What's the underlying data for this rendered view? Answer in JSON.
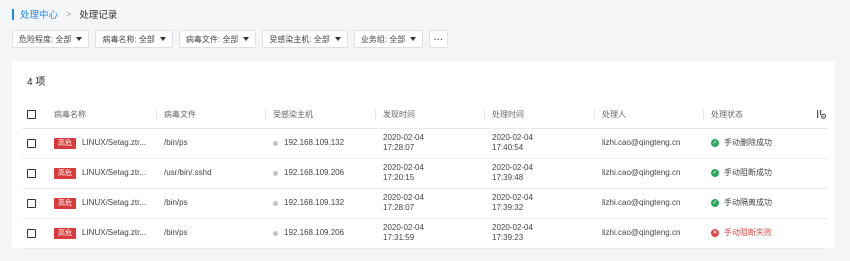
{
  "breadcrumb": {
    "parent": "处理中心",
    "separator": ">",
    "current": "处理记录"
  },
  "filters": [
    {
      "label": "危险程度: 全部"
    },
    {
      "label": "病毒名称: 全部"
    },
    {
      "label": "病毒文件: 全部"
    },
    {
      "label": "受感染主机: 全部"
    },
    {
      "label": "业务组: 全部"
    }
  ],
  "more_label": "···",
  "count_label": "4 项",
  "columns": {
    "name": "病毒名称",
    "file": "病毒文件",
    "host": "受感染主机",
    "found": "发现时间",
    "handled": "处理时间",
    "handler": "处理人",
    "status": "处理状态"
  },
  "rows": [
    {
      "severity": "高危",
      "name": "LINUX/Setag.ztr...",
      "file": "/bin/ps",
      "host": "192.168.109.132",
      "found_date": "2020-02-04",
      "found_time": "17:28:07",
      "handled_date": "2020-02-04",
      "handled_time": "17:40:54",
      "handler": "lizhi.cao@qingteng.cn",
      "status": "手动删除成功",
      "status_type": "success"
    },
    {
      "severity": "高危",
      "name": "LINUX/Setag.ztr...",
      "file": "/usr/bin/.sshd",
      "host": "192.168.109.206",
      "found_date": "2020-02-04",
      "found_time": "17:20:15",
      "handled_date": "2020-02-04",
      "handled_time": "17:39:48",
      "handler": "lizhi.cao@qingteng.cn",
      "status": "手动阻断成功",
      "status_type": "success"
    },
    {
      "severity": "高危",
      "name": "LINUX/Setag.ztr...",
      "file": "/bin/ps",
      "host": "192.168.109.132",
      "found_date": "2020-02-04",
      "found_time": "17:28:07",
      "handled_date": "2020-02-04",
      "handled_time": "17:39:32",
      "handler": "lizhi.cao@qingteng.cn",
      "status": "手动隔离成功",
      "status_type": "success"
    },
    {
      "severity": "高危",
      "name": "LINUX/Setag.ztr...",
      "file": "/bin/ps",
      "host": "192.168.109.206",
      "found_date": "2020-02-04",
      "found_time": "17:31:59",
      "handled_date": "2020-02-04",
      "handled_time": "17:39:23",
      "handler": "lizhi.cao@qingteng.cn",
      "status": "手动阻断失败",
      "status_type": "fail"
    }
  ],
  "colors": {
    "accent": "#1e88e5",
    "severity_high": "#d93a3a",
    "success": "#27a85a",
    "fail": "#e04545"
  },
  "icons": {
    "status_success": "check-circle-icon",
    "status_fail": "x-circle-icon",
    "column_settings": "column-settings-icon"
  }
}
